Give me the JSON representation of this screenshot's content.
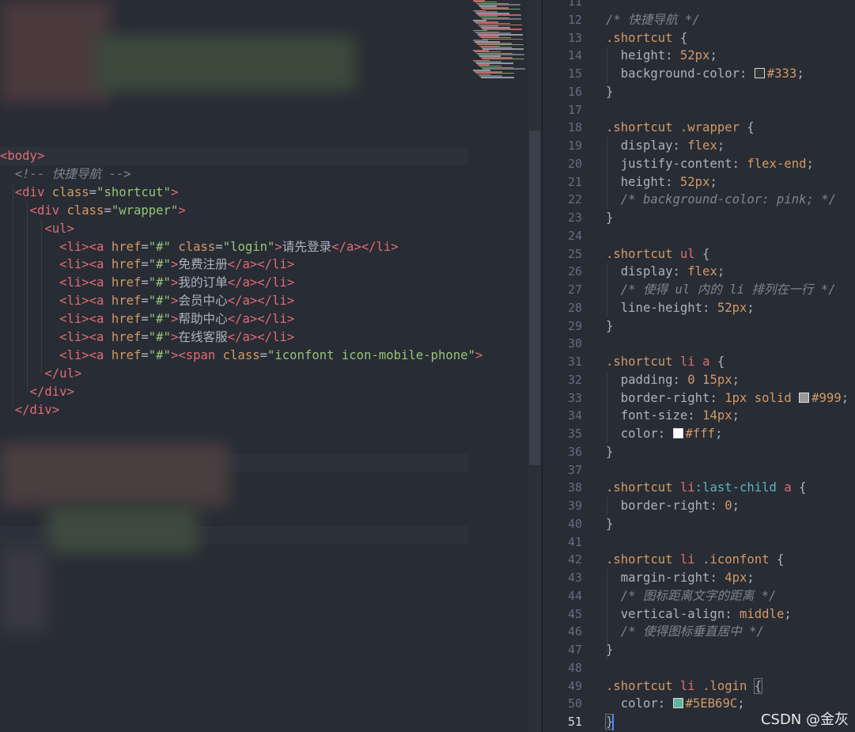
{
  "left_editor": {
    "lines": [
      {
        "segs": [
          {
            "c": "tag",
            "t": "<body>"
          }
        ]
      },
      {
        "segs": [
          {
            "c": "cmt",
            "t": "  <!-- 快捷导航 -->"
          }
        ]
      },
      {
        "segs": [
          {
            "c": "tag",
            "t": "  <div "
          },
          {
            "c": "attr",
            "t": "class"
          },
          {
            "c": "txt",
            "t": "="
          },
          {
            "c": "str",
            "t": "\"shortcut\""
          },
          {
            "c": "tag",
            "t": ">"
          }
        ]
      },
      {
        "segs": [
          {
            "c": "tag",
            "t": "    <div "
          },
          {
            "c": "attr",
            "t": "class"
          },
          {
            "c": "txt",
            "t": "="
          },
          {
            "c": "str",
            "t": "\"wrapper\""
          },
          {
            "c": "tag",
            "t": ">"
          }
        ]
      },
      {
        "segs": [
          {
            "c": "tag",
            "t": "      <ul>"
          }
        ]
      },
      {
        "segs": [
          {
            "c": "tag",
            "t": "        <li><a "
          },
          {
            "c": "attr",
            "t": "href"
          },
          {
            "c": "txt",
            "t": "="
          },
          {
            "c": "str",
            "t": "\"#\""
          },
          {
            "c": "txt",
            "t": " "
          },
          {
            "c": "attr",
            "t": "class"
          },
          {
            "c": "txt",
            "t": "="
          },
          {
            "c": "str",
            "t": "\"login\""
          },
          {
            "c": "tag",
            "t": ">"
          },
          {
            "c": "txt",
            "t": "请先登录"
          },
          {
            "c": "tag",
            "t": "</a></li>"
          }
        ]
      },
      {
        "segs": [
          {
            "c": "tag",
            "t": "        <li><a "
          },
          {
            "c": "attr",
            "t": "href"
          },
          {
            "c": "txt",
            "t": "="
          },
          {
            "c": "str",
            "t": "\"#\""
          },
          {
            "c": "tag",
            "t": ">"
          },
          {
            "c": "txt",
            "t": "免费注册"
          },
          {
            "c": "tag",
            "t": "</a></li>"
          }
        ]
      },
      {
        "segs": [
          {
            "c": "tag",
            "t": "        <li><a "
          },
          {
            "c": "attr",
            "t": "href"
          },
          {
            "c": "txt",
            "t": "="
          },
          {
            "c": "str",
            "t": "\"#\""
          },
          {
            "c": "tag",
            "t": ">"
          },
          {
            "c": "txt",
            "t": "我的订单"
          },
          {
            "c": "tag",
            "t": "</a></li>"
          }
        ]
      },
      {
        "segs": [
          {
            "c": "tag",
            "t": "        <li><a "
          },
          {
            "c": "attr",
            "t": "href"
          },
          {
            "c": "txt",
            "t": "="
          },
          {
            "c": "str",
            "t": "\"#\""
          },
          {
            "c": "tag",
            "t": ">"
          },
          {
            "c": "txt",
            "t": "会员中心"
          },
          {
            "c": "tag",
            "t": "</a></li>"
          }
        ]
      },
      {
        "segs": [
          {
            "c": "tag",
            "t": "        <li><a "
          },
          {
            "c": "attr",
            "t": "href"
          },
          {
            "c": "txt",
            "t": "="
          },
          {
            "c": "str",
            "t": "\"#\""
          },
          {
            "c": "tag",
            "t": ">"
          },
          {
            "c": "txt",
            "t": "帮助中心"
          },
          {
            "c": "tag",
            "t": "</a></li>"
          }
        ]
      },
      {
        "segs": [
          {
            "c": "tag",
            "t": "        <li><a "
          },
          {
            "c": "attr",
            "t": "href"
          },
          {
            "c": "txt",
            "t": "="
          },
          {
            "c": "str",
            "t": "\"#\""
          },
          {
            "c": "tag",
            "t": ">"
          },
          {
            "c": "txt",
            "t": "在线客服"
          },
          {
            "c": "tag",
            "t": "</a></li>"
          }
        ]
      },
      {
        "segs": [
          {
            "c": "tag",
            "t": "        <li><a "
          },
          {
            "c": "attr",
            "t": "href"
          },
          {
            "c": "txt",
            "t": "="
          },
          {
            "c": "str",
            "t": "\"#\""
          },
          {
            "c": "tag",
            "t": "><span "
          },
          {
            "c": "attr",
            "t": "class"
          },
          {
            "c": "txt",
            "t": "="
          },
          {
            "c": "str",
            "t": "\"iconfont icon-mobile-phone\""
          },
          {
            "c": "tag",
            "t": ">"
          }
        ]
      },
      {
        "segs": [
          {
            "c": "tag",
            "t": "      </ul>"
          }
        ]
      },
      {
        "segs": [
          {
            "c": "tag",
            "t": "    </div>"
          }
        ]
      },
      {
        "segs": [
          {
            "c": "tag",
            "t": "  </div>"
          }
        ]
      }
    ]
  },
  "right_editor": {
    "first_line_number": 11,
    "active_line_number": 51,
    "lines": [
      {
        "segs": []
      },
      {
        "segs": [
          {
            "c": "cmt",
            "t": "/* 快捷导航 */"
          }
        ]
      },
      {
        "segs": [
          {
            "c": "sel",
            "t": ".shortcut"
          },
          {
            "c": "punc",
            "t": " {"
          }
        ]
      },
      {
        "segs": [
          {
            "c": "prop",
            "t": "  height"
          },
          {
            "c": "punc",
            "t": ": "
          },
          {
            "c": "num",
            "t": "52px"
          },
          {
            "c": "punc",
            "t": ";"
          }
        ]
      },
      {
        "segs": [
          {
            "c": "prop",
            "t": "  background-color"
          },
          {
            "c": "punc",
            "t": ": "
          },
          {
            "c": "swatch",
            "t": "#333333"
          },
          {
            "c": "kw",
            "t": "#333"
          },
          {
            "c": "punc",
            "t": ";"
          }
        ]
      },
      {
        "segs": [
          {
            "c": "punc",
            "t": "}"
          }
        ]
      },
      {
        "segs": []
      },
      {
        "segs": [
          {
            "c": "sel",
            "t": ".shortcut"
          },
          {
            "c": "txt",
            "t": " "
          },
          {
            "c": "sel",
            "t": ".wrapper"
          },
          {
            "c": "punc",
            "t": " {"
          }
        ]
      },
      {
        "segs": [
          {
            "c": "prop",
            "t": "  display"
          },
          {
            "c": "punc",
            "t": ": "
          },
          {
            "c": "kw",
            "t": "flex"
          },
          {
            "c": "punc",
            "t": ";"
          }
        ]
      },
      {
        "segs": [
          {
            "c": "prop",
            "t": "  justify-content"
          },
          {
            "c": "punc",
            "t": ": "
          },
          {
            "c": "kw",
            "t": "flex-end"
          },
          {
            "c": "punc",
            "t": ";"
          }
        ]
      },
      {
        "segs": [
          {
            "c": "prop",
            "t": "  height"
          },
          {
            "c": "punc",
            "t": ": "
          },
          {
            "c": "num",
            "t": "52px"
          },
          {
            "c": "punc",
            "t": ";"
          }
        ]
      },
      {
        "segs": [
          {
            "c": "cmt",
            "t": "  /* background-color: pink; */"
          }
        ]
      },
      {
        "segs": [
          {
            "c": "punc",
            "t": "}"
          }
        ]
      },
      {
        "segs": []
      },
      {
        "segs": [
          {
            "c": "sel",
            "t": ".shortcut"
          },
          {
            "c": "txt",
            "t": " "
          },
          {
            "c": "el",
            "t": "ul"
          },
          {
            "c": "punc",
            "t": " {"
          }
        ]
      },
      {
        "segs": [
          {
            "c": "prop",
            "t": "  display"
          },
          {
            "c": "punc",
            "t": ": "
          },
          {
            "c": "kw",
            "t": "flex"
          },
          {
            "c": "punc",
            "t": ";"
          }
        ]
      },
      {
        "segs": [
          {
            "c": "cmt",
            "t": "  /* 使得 ul 内的 li 排列在一行 */"
          }
        ]
      },
      {
        "segs": [
          {
            "c": "prop",
            "t": "  line-height"
          },
          {
            "c": "punc",
            "t": ": "
          },
          {
            "c": "num",
            "t": "52px"
          },
          {
            "c": "punc",
            "t": ";"
          }
        ]
      },
      {
        "segs": [
          {
            "c": "punc",
            "t": "}"
          }
        ]
      },
      {
        "segs": []
      },
      {
        "segs": [
          {
            "c": "sel",
            "t": ".shortcut"
          },
          {
            "c": "txt",
            "t": " "
          },
          {
            "c": "el",
            "t": "li"
          },
          {
            "c": "txt",
            "t": " "
          },
          {
            "c": "el",
            "t": "a"
          },
          {
            "c": "punc",
            "t": " {"
          }
        ]
      },
      {
        "segs": [
          {
            "c": "prop",
            "t": "  padding"
          },
          {
            "c": "punc",
            "t": ": "
          },
          {
            "c": "num",
            "t": "0 15px"
          },
          {
            "c": "punc",
            "t": ";"
          }
        ]
      },
      {
        "segs": [
          {
            "c": "prop",
            "t": "  border-right"
          },
          {
            "c": "punc",
            "t": ": "
          },
          {
            "c": "num",
            "t": "1px"
          },
          {
            "c": "txt",
            "t": " "
          },
          {
            "c": "kw",
            "t": "solid"
          },
          {
            "c": "txt",
            "t": " "
          },
          {
            "c": "swatch",
            "t": "#999999"
          },
          {
            "c": "kw",
            "t": "#999"
          },
          {
            "c": "punc",
            "t": ";"
          }
        ]
      },
      {
        "segs": [
          {
            "c": "prop",
            "t": "  font-size"
          },
          {
            "c": "punc",
            "t": ": "
          },
          {
            "c": "num",
            "t": "14px"
          },
          {
            "c": "punc",
            "t": ";"
          }
        ]
      },
      {
        "segs": [
          {
            "c": "prop",
            "t": "  color"
          },
          {
            "c": "punc",
            "t": ": "
          },
          {
            "c": "swatch",
            "t": "#ffffff"
          },
          {
            "c": "kw",
            "t": "#fff"
          },
          {
            "c": "punc",
            "t": ";"
          }
        ]
      },
      {
        "segs": [
          {
            "c": "punc",
            "t": "}"
          }
        ]
      },
      {
        "segs": []
      },
      {
        "segs": [
          {
            "c": "sel",
            "t": ".shortcut"
          },
          {
            "c": "txt",
            "t": " "
          },
          {
            "c": "el",
            "t": "li"
          },
          {
            "c": "pseudo",
            "t": ":last-child"
          },
          {
            "c": "txt",
            "t": " "
          },
          {
            "c": "el",
            "t": "a"
          },
          {
            "c": "punc",
            "t": " {"
          }
        ]
      },
      {
        "segs": [
          {
            "c": "prop",
            "t": "  border-right"
          },
          {
            "c": "punc",
            "t": ": "
          },
          {
            "c": "num",
            "t": "0"
          },
          {
            "c": "punc",
            "t": ";"
          }
        ]
      },
      {
        "segs": [
          {
            "c": "punc",
            "t": "}"
          }
        ]
      },
      {
        "segs": []
      },
      {
        "segs": [
          {
            "c": "sel",
            "t": ".shortcut"
          },
          {
            "c": "txt",
            "t": " "
          },
          {
            "c": "el",
            "t": "li"
          },
          {
            "c": "txt",
            "t": " "
          },
          {
            "c": "sel",
            "t": ".iconfont"
          },
          {
            "c": "punc",
            "t": " {"
          }
        ]
      },
      {
        "segs": [
          {
            "c": "prop",
            "t": "  margin-right"
          },
          {
            "c": "punc",
            "t": ": "
          },
          {
            "c": "num",
            "t": "4px"
          },
          {
            "c": "punc",
            "t": ";"
          }
        ]
      },
      {
        "segs": [
          {
            "c": "cmt",
            "t": "  /* 图标距离文字的距离 */"
          }
        ]
      },
      {
        "segs": [
          {
            "c": "prop",
            "t": "  vertical-align"
          },
          {
            "c": "punc",
            "t": ": "
          },
          {
            "c": "kw",
            "t": "middle"
          },
          {
            "c": "punc",
            "t": ";"
          }
        ]
      },
      {
        "segs": [
          {
            "c": "cmt",
            "t": "  /* 使得图标垂直居中 */"
          }
        ]
      },
      {
        "segs": [
          {
            "c": "punc",
            "t": "}"
          }
        ]
      },
      {
        "segs": []
      },
      {
        "segs": [
          {
            "c": "sel",
            "t": ".shortcut"
          },
          {
            "c": "txt",
            "t": " "
          },
          {
            "c": "el",
            "t": "li"
          },
          {
            "c": "txt",
            "t": " "
          },
          {
            "c": "sel",
            "t": ".login"
          },
          {
            "c": "punc",
            "t": " "
          },
          {
            "c": "match",
            "t": "{"
          }
        ]
      },
      {
        "segs": [
          {
            "c": "prop",
            "t": "  color"
          },
          {
            "c": "punc",
            "t": ": "
          },
          {
            "c": "swatch",
            "t": "#5EB69C"
          },
          {
            "c": "kw",
            "t": "#5EB69C"
          },
          {
            "c": "punc",
            "t": ";"
          }
        ]
      },
      {
        "segs": [
          {
            "c": "match",
            "t": "}"
          }
        ]
      }
    ]
  },
  "watermark": "CSDN @金灰"
}
